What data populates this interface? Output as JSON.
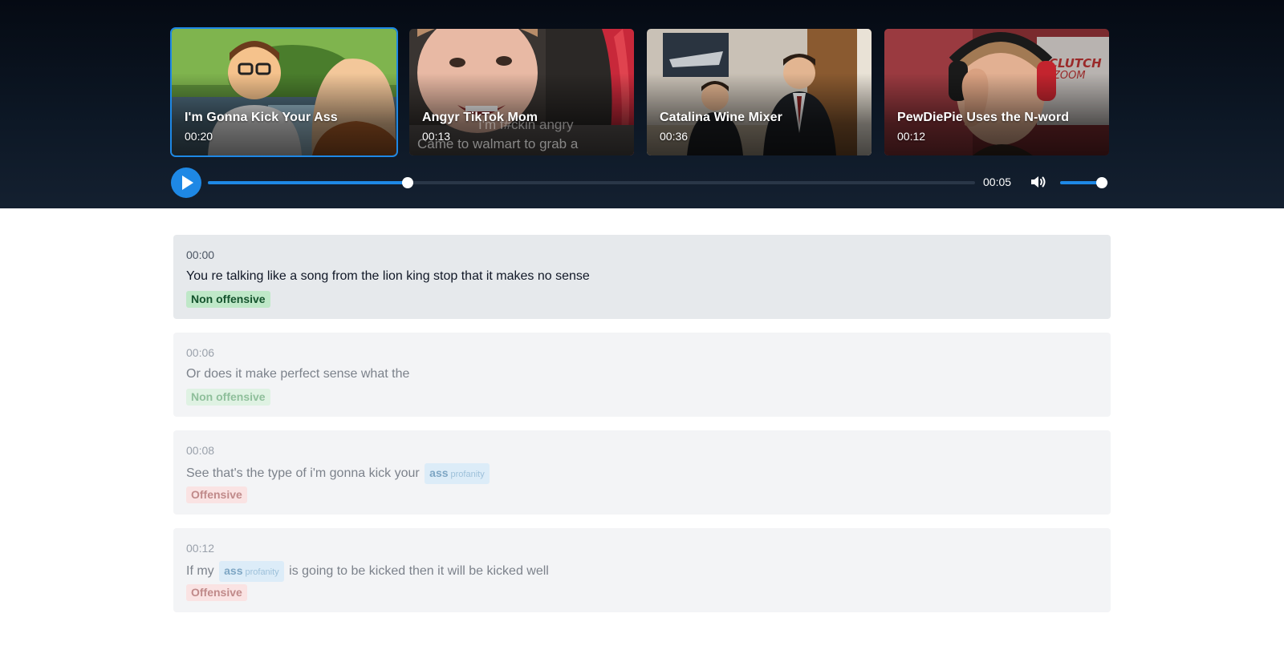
{
  "player": {
    "videos": [
      {
        "title": "I'm Gonna Kick Your Ass",
        "duration": "00:20",
        "selected": true
      },
      {
        "title": "Angyr TikTok Mom",
        "duration": "00:13",
        "selected": false,
        "overlay_caption": "Came to walmart to grab a",
        "overlay_caption_2": "I'm f#ckin angry"
      },
      {
        "title": "Catalina Wine Mixer",
        "duration": "00:36",
        "selected": false
      },
      {
        "title": "PewDiePie Uses the N-word",
        "duration": "00:12",
        "selected": false
      }
    ],
    "controls": {
      "current_time": "00:05",
      "progress_fraction": 0.26,
      "volume_fraction": 0.87,
      "play_icon": "play-icon",
      "volume_icon": "speaker-icon"
    },
    "colors": {
      "accent": "#1e88e5"
    }
  },
  "transcript": {
    "segments": [
      {
        "time": "00:00",
        "parts": [
          {
            "text": "You re talking like a song from the lion king stop that it makes no sense"
          }
        ],
        "label": "Non offensive",
        "active": true
      },
      {
        "time": "00:06",
        "parts": [
          {
            "text": "Or does it make perfect sense what the"
          }
        ],
        "label": "Non offensive",
        "active": false
      },
      {
        "time": "00:08",
        "parts": [
          {
            "text": "See that's the type of i'm gonna kick your"
          },
          {
            "word": "ass",
            "tag": "profanity"
          }
        ],
        "label": "Offensive",
        "active": false
      },
      {
        "time": "00:12",
        "parts": [
          {
            "text": "If my"
          },
          {
            "word": "ass",
            "tag": "profanity"
          },
          {
            "text": "is going to be kicked then it will be kicked well"
          }
        ],
        "label": "Offensive",
        "active": false
      }
    ]
  }
}
